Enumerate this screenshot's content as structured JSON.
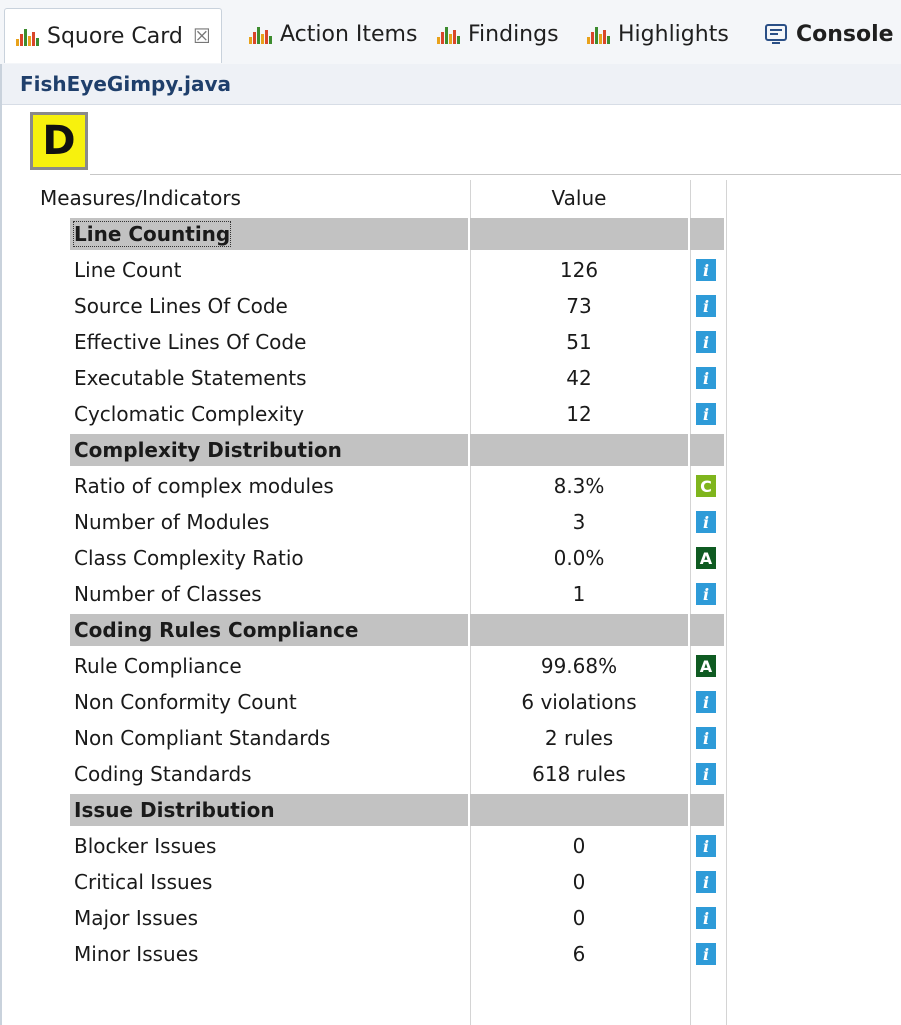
{
  "tabs": [
    {
      "label": "Squore Card",
      "icon": "bar-chart-icon",
      "close": "☒",
      "active": true
    },
    {
      "label": "Action Items",
      "icon": "bar-chart-icon"
    },
    {
      "label": "Findings",
      "icon": "bar-chart-icon"
    },
    {
      "label": "Highlights",
      "icon": "bar-chart-icon"
    },
    {
      "label": "Console",
      "icon": "console-icon"
    }
  ],
  "file": {
    "name": "FishEyeGimpy.java",
    "grade": "D",
    "grade_color": "#f7f10d"
  },
  "table": {
    "headers": {
      "name": "Measures/Indicators",
      "value": "Value"
    },
    "rows": [
      {
        "type": "section",
        "name": "Line Counting"
      },
      {
        "type": "measure",
        "name": "Line Count",
        "value": "126",
        "indicator": "i"
      },
      {
        "type": "measure",
        "name": "Source Lines Of Code",
        "value": "73",
        "indicator": "i"
      },
      {
        "type": "measure",
        "name": "Effective Lines Of Code",
        "value": "51",
        "indicator": "i"
      },
      {
        "type": "measure",
        "name": "Executable Statements",
        "value": "42",
        "indicator": "i"
      },
      {
        "type": "measure",
        "name": "Cyclomatic Complexity",
        "value": "12",
        "indicator": "i"
      },
      {
        "type": "section",
        "name": "Complexity Distribution"
      },
      {
        "type": "measure",
        "name": "Ratio of complex modules",
        "value": "8.3%",
        "indicator": "C"
      },
      {
        "type": "measure",
        "name": "Number of Modules",
        "value": "3",
        "indicator": "i"
      },
      {
        "type": "measure",
        "name": "Class Complexity Ratio",
        "value": "0.0%",
        "indicator": "A"
      },
      {
        "type": "measure",
        "name": "Number of Classes",
        "value": "1",
        "indicator": "i"
      },
      {
        "type": "section",
        "name": "Coding Rules Compliance"
      },
      {
        "type": "measure",
        "name": "Rule Compliance",
        "value": "99.68%",
        "indicator": "A"
      },
      {
        "type": "measure",
        "name": "Non Conformity Count",
        "value": "6 violations",
        "indicator": "i"
      },
      {
        "type": "measure",
        "name": "Non Compliant Standards",
        "value": "2 rules",
        "indicator": "i"
      },
      {
        "type": "measure",
        "name": "Coding Standards",
        "value": "618 rules",
        "indicator": "i"
      },
      {
        "type": "section",
        "name": "Issue Distribution"
      },
      {
        "type": "measure",
        "name": "Blocker Issues",
        "value": "0",
        "indicator": "i"
      },
      {
        "type": "measure",
        "name": "Critical Issues",
        "value": "0",
        "indicator": "i"
      },
      {
        "type": "measure",
        "name": "Major Issues",
        "value": "0",
        "indicator": "i"
      },
      {
        "type": "measure",
        "name": "Minor Issues",
        "value": "6",
        "indicator": "i"
      }
    ]
  },
  "colors": {
    "info": "#2e9bd8",
    "grade_A": "#0f5b22",
    "grade_C": "#7fb51d",
    "section_bg": "#c2c2c2"
  }
}
